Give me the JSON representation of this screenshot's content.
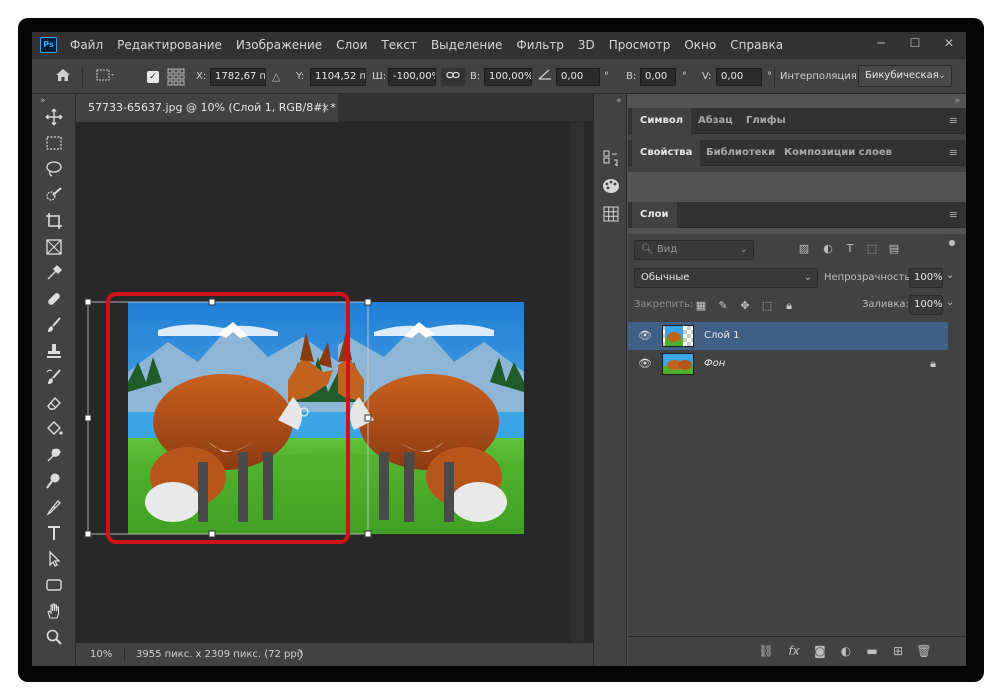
{
  "app": {
    "logo_text": "Ps",
    "menu": [
      "Файл",
      "Редактирование",
      "Изображение",
      "Слои",
      "Текст",
      "Выделение",
      "Фильтр",
      "3D",
      "Просмотр",
      "Окно",
      "Справка"
    ],
    "window_controls": {
      "minimize": "─",
      "maximize": "☐",
      "close": "✕"
    }
  },
  "options": {
    "x_label": "X:",
    "x_value": "1782,67 пі",
    "delta_icon": "△",
    "y_label": "Y:",
    "y_value": "1104,52 пі",
    "w_label": "Ш:",
    "w_value": "-100,00%",
    "link_icon": "chain-link-icon",
    "h_label": "В:",
    "h_value": "100,00%",
    "angle_value": "0,00",
    "degree": "°",
    "hskew_label": "В:",
    "hskew_value": "0,00",
    "vskew_label": "V:",
    "vskew_value": "0,00",
    "interp_label": "Интерполяция:",
    "interp_value": "Бикубическая"
  },
  "document": {
    "tab_title": "57733-65637.jpg @ 10% (Слой 1, RGB/8#) *",
    "close": "×",
    "zoom": "10%",
    "doc_info": "3955 пикс. x 2309 пикс. (72 ppi)",
    "status_arrow": "〉"
  },
  "panels": {
    "collapse": "»",
    "collapse_left": "«",
    "group1_tabs": [
      "Символ",
      "Абзац",
      "Глифы"
    ],
    "group2_tabs": [
      "Свойства",
      "Библиотеки",
      "Композиции слоев"
    ],
    "group3_tabs": [
      "Слои"
    ],
    "menu_icon": "≡"
  },
  "layers": {
    "filter_placeholder": "Вид",
    "blend_mode": "Обычные",
    "opacity_label": "Непрозрачность:",
    "opacity_value": "100%",
    "lock_label": "Закрепить:",
    "fill_label": "Заливка:",
    "fill_value": "100%",
    "items": [
      {
        "name": "Слой 1",
        "selected": true,
        "locked": false
      },
      {
        "name": "Фон",
        "selected": false,
        "locked": true
      }
    ]
  },
  "colors": {
    "accent_selection": "#3f5f85",
    "highlight_box": "#d0121b",
    "panel_bg": "#424242",
    "canvas_bg": "#282828"
  }
}
